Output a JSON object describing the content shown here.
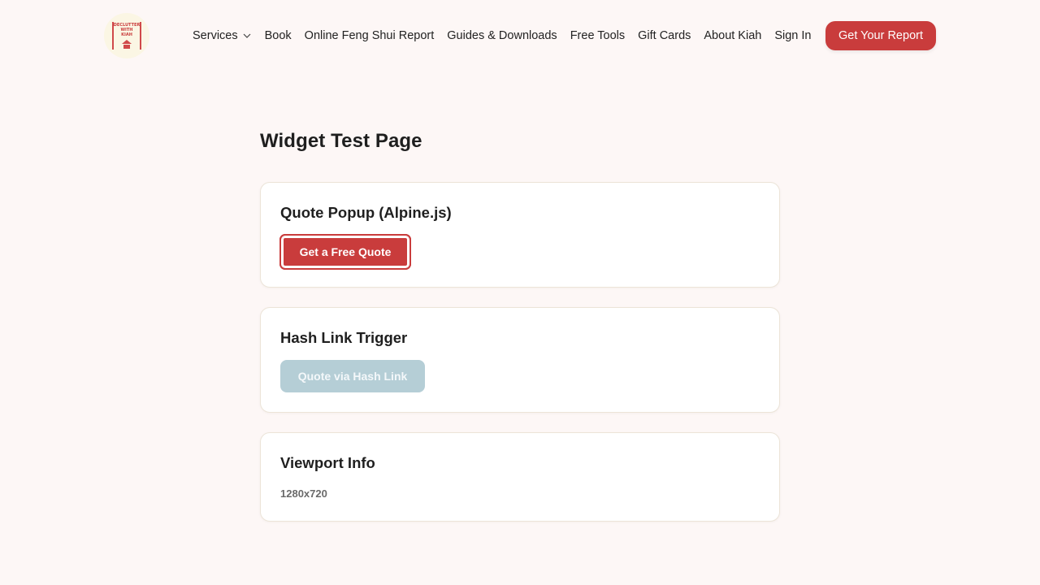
{
  "header": {
    "logo": {
      "text_line1": "DECLUTTER",
      "text_line2": "WITH",
      "text_line3": "KIAH",
      "icon": "house-icon"
    },
    "nav": [
      {
        "label": "Services",
        "has_dropdown": true
      },
      {
        "label": "Book"
      },
      {
        "label": "Online Feng Shui Report"
      },
      {
        "label": "Guides & Downloads"
      },
      {
        "label": "Free Tools"
      },
      {
        "label": "Gift Cards"
      },
      {
        "label": "About Kiah"
      },
      {
        "label": "Sign In"
      }
    ],
    "cta_label": "Get Your Report"
  },
  "main": {
    "title": "Widget Test Page",
    "cards": [
      {
        "title": "Quote Popup (Alpine.js)",
        "button_label": "Get a Free Quote"
      },
      {
        "title": "Hash Link Trigger",
        "button_label": "Quote via Hash Link"
      },
      {
        "title": "Viewport Info",
        "value": "1280x720"
      }
    ]
  },
  "colors": {
    "background": "#fdf7f6",
    "accent": "#c93c3c",
    "secondary_button": "#b5ced6",
    "card_border": "#ece4d8"
  }
}
